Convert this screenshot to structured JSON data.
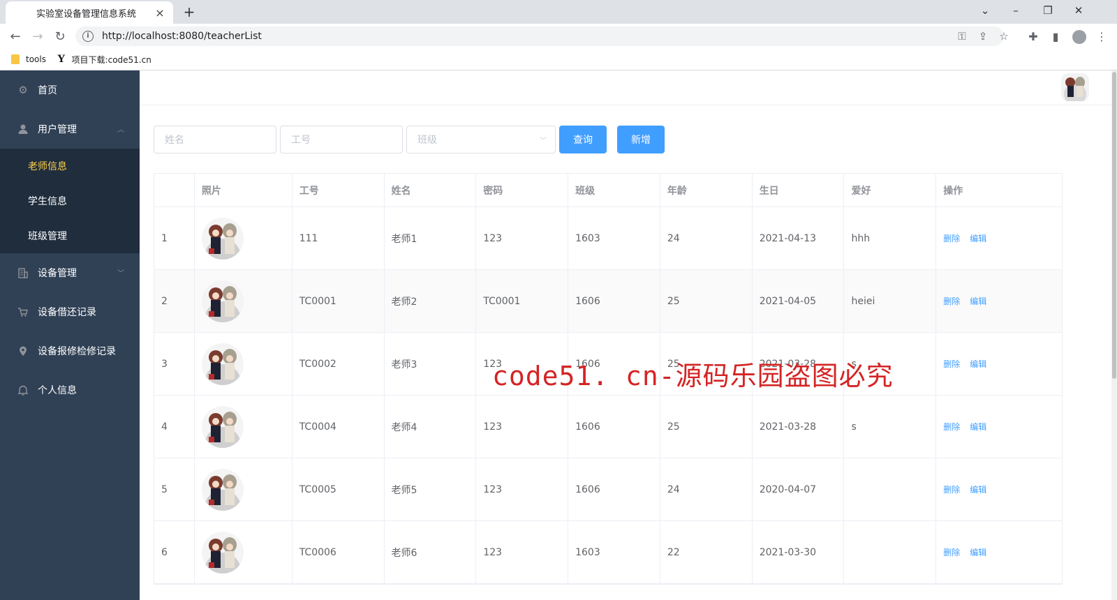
{
  "browser": {
    "tab_title": "实验室设备管理信息系统",
    "tab_close": "×",
    "new_tab": "+",
    "url": "http://localhost:8080/teacherList",
    "bookmarks": [
      {
        "label": "tools",
        "icon": "folder-icon"
      },
      {
        "label": "项目下载:code51.cn",
        "icon": "y-logo-icon"
      }
    ]
  },
  "sidebar": {
    "items": [
      {
        "label": "首页",
        "icon": "gear-icon"
      },
      {
        "label": "用户管理",
        "icon": "user-icon",
        "expanded": true
      },
      {
        "label": "设备管理",
        "icon": "building-icon",
        "expanded": false
      },
      {
        "label": "设备借还记录",
        "icon": "cart-icon"
      },
      {
        "label": "设备报修检修记录",
        "icon": "location-icon"
      },
      {
        "label": "个人信息",
        "icon": "bell-icon"
      }
    ],
    "submenu": [
      {
        "label": "老师信息",
        "active": true
      },
      {
        "label": "学生信息",
        "active": false
      },
      {
        "label": "班级管理",
        "active": false
      }
    ],
    "colors": {
      "background": "#304156",
      "active": "#ffd04b"
    }
  },
  "filters": {
    "name_placeholder": "姓名",
    "id_placeholder": "工号",
    "class_placeholder": "班级",
    "search_label": "查询",
    "add_label": "新增"
  },
  "table": {
    "headers": [
      "",
      "照片",
      "工号",
      "姓名",
      "密码",
      "班级",
      "年龄",
      "生日",
      "爱好",
      "操作"
    ],
    "rows": [
      {
        "index": "1",
        "id": "111",
        "name": "老师1",
        "password": "123",
        "class": "1603",
        "age": "24",
        "birthday": "2021-04-13",
        "hobby": "hhh"
      },
      {
        "index": "2",
        "id": "TC0001",
        "name": "老师2",
        "password": "TC0001",
        "class": "1606",
        "age": "25",
        "birthday": "2021-04-05",
        "hobby": "heiei"
      },
      {
        "index": "3",
        "id": "TC0002",
        "name": "老师3",
        "password": "123",
        "class": "1606",
        "age": "25",
        "birthday": "2021-03-28",
        "hobby": "s"
      },
      {
        "index": "4",
        "id": "TC0004",
        "name": "老师4",
        "password": "123",
        "class": "1606",
        "age": "25",
        "birthday": "2021-03-28",
        "hobby": "s"
      },
      {
        "index": "5",
        "id": "TC0005",
        "name": "老师5",
        "password": "123",
        "class": "1606",
        "age": "24",
        "birthday": "2020-04-07",
        "hobby": ""
      },
      {
        "index": "6",
        "id": "TC0006",
        "name": "老师6",
        "password": "123",
        "class": "1603",
        "age": "22",
        "birthday": "2021-03-30",
        "hobby": ""
      }
    ],
    "ops": {
      "delete": "删除",
      "edit": "编辑"
    }
  },
  "watermark": "code51. cn-源码乐园盗图必究",
  "accent_color": "#409eff"
}
